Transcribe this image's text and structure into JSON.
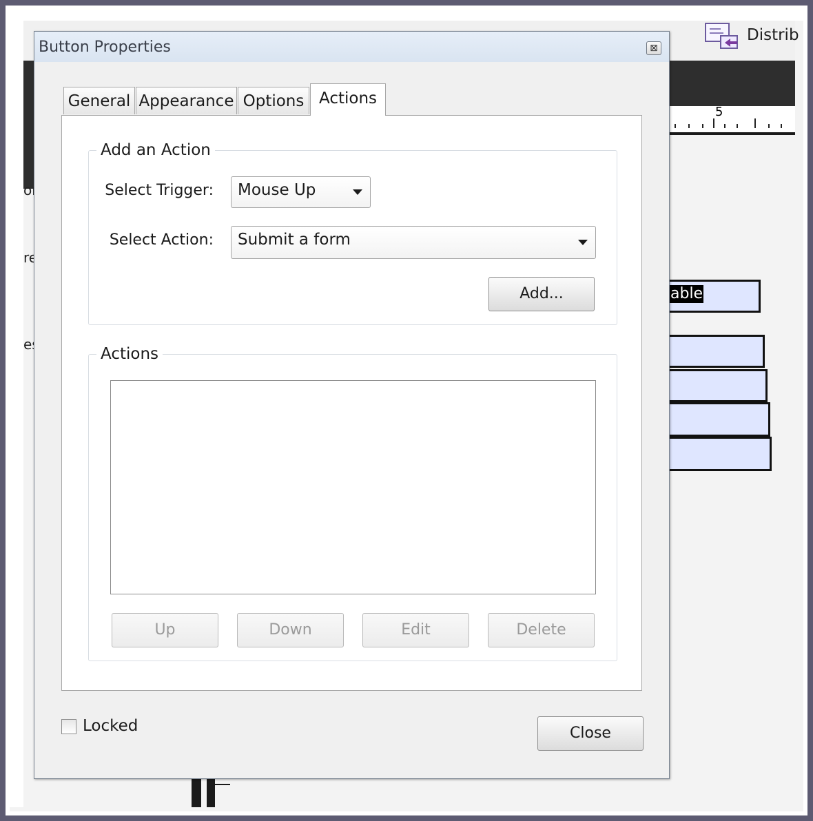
{
  "background_app": {
    "toolbar_label_partial": "Distrib",
    "ruler_number": "5",
    "selected_field_text": "able",
    "left_fragments": [
      "or",
      "re",
      "es"
    ]
  },
  "dialog": {
    "title": "Button Properties",
    "close_glyph": "⊠",
    "tabs": [
      {
        "label": "General",
        "active": false
      },
      {
        "label": "Appearance",
        "active": false
      },
      {
        "label": "Options",
        "active": false
      },
      {
        "label": "Actions",
        "active": true
      }
    ],
    "add_action_group": {
      "legend": "Add an Action",
      "trigger_label": "Select Trigger:",
      "trigger_value": "Mouse Up",
      "action_label": "Select Action:",
      "action_value": "Submit a form",
      "add_button": "Add..."
    },
    "actions_group": {
      "legend": "Actions",
      "items": [],
      "buttons": {
        "up": "Up",
        "down": "Down",
        "edit": "Edit",
        "delete": "Delete"
      }
    },
    "locked_label": "Locked",
    "locked_checked": false,
    "close_button": "Close"
  }
}
